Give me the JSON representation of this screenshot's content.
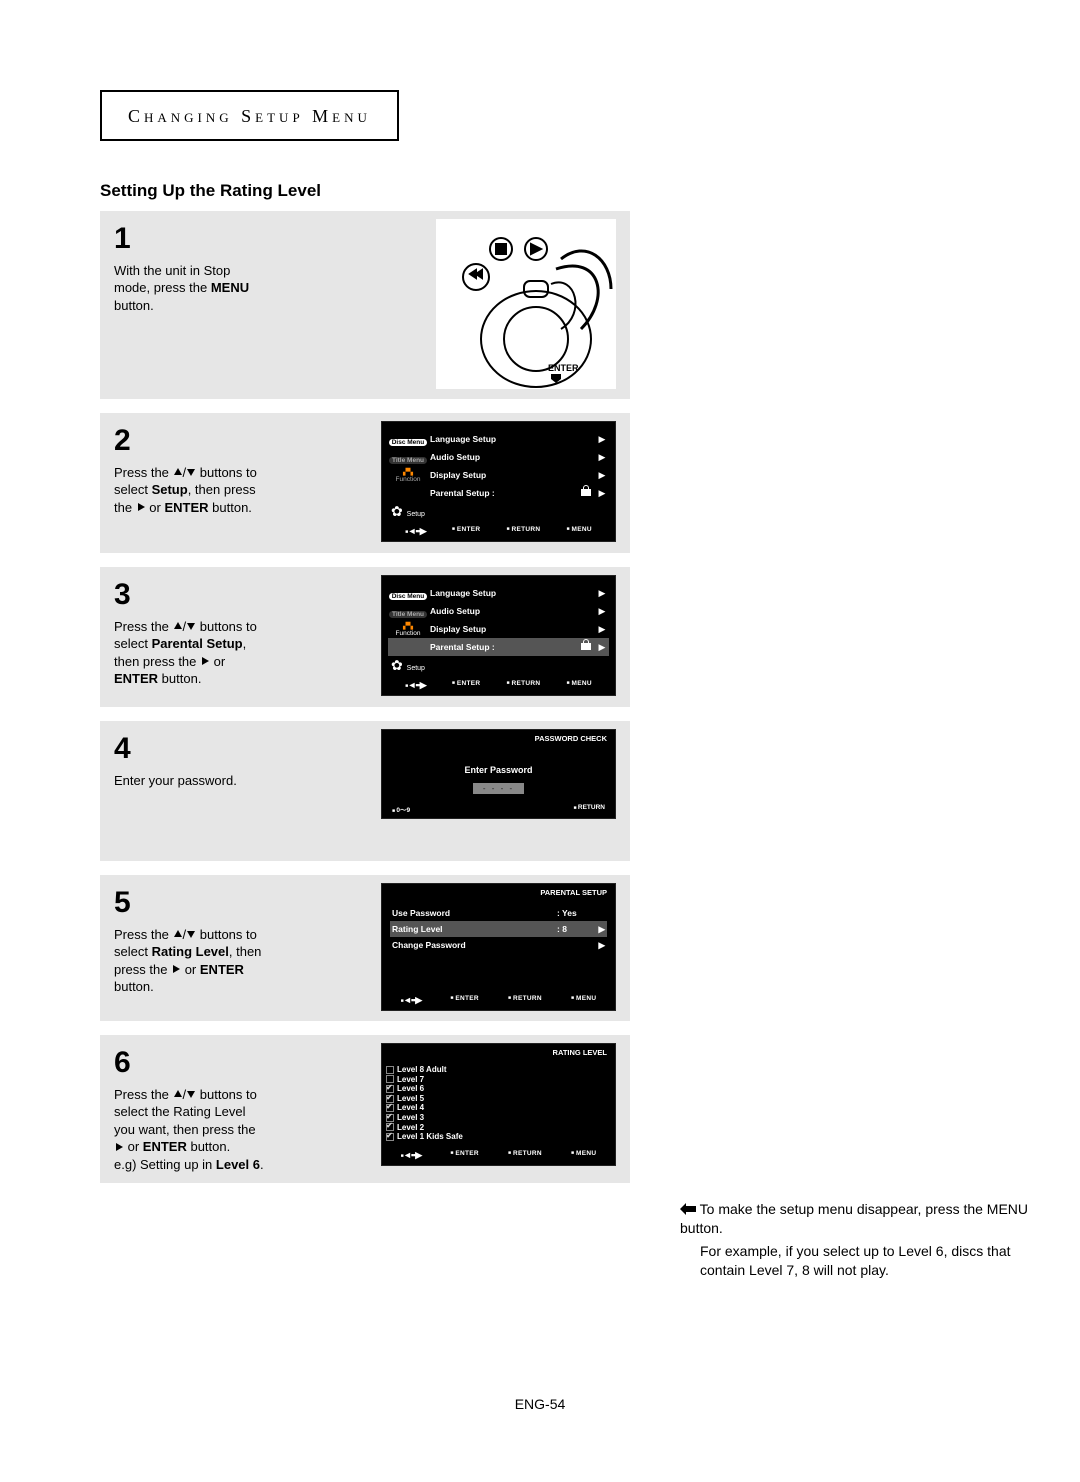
{
  "chapter": "Changing Setup Menu",
  "section_title": "Setting Up the Rating Level",
  "page_number": "ENG-54",
  "steps": {
    "s1": {
      "num": "1",
      "line1": "With the unit in Stop",
      "line2_pre": "mode, press the ",
      "line2_bold": "MENU",
      "line3": "button."
    },
    "s2": {
      "num": "2",
      "line1_pre": "Press the ",
      "line1_post": " buttons to",
      "line2_pre": "select ",
      "line2_bold": "Setup",
      "line2_post": ", then press",
      "line3_pre": "the ",
      "line3_post": " or ",
      "line3_bold": "ENTER",
      "line3_end": " button."
    },
    "s3": {
      "num": "3",
      "line1_pre": "Press the ",
      "line1_post": " buttons to",
      "line2_pre": "select ",
      "line2_bold": "Parental Setup",
      "line2_post": ",",
      "line3_pre": "then press the ",
      "line3_post": " or",
      "line4_bold": "ENTER",
      "line4_post": " button."
    },
    "s4": {
      "num": "4",
      "line1": "Enter your password."
    },
    "s5": {
      "num": "5",
      "line1_pre": "Press the ",
      "line1_post": " buttons to",
      "line2_pre": "select ",
      "line2_bold": "Rating Level",
      "line2_post": ", then",
      "line3_pre": "press the ",
      "line3_post": " or ",
      "line3_bold": "ENTER",
      "line4": "button."
    },
    "s6": {
      "num": "6",
      "line1_pre": "Press the ",
      "line1_post": " buttons to",
      "line2": "select the Rating Level",
      "line3": "you want, then press the",
      "line4_pre": "",
      "line4_mid": " or ",
      "line4_bold": "ENTER",
      "line4_post": " button.",
      "line5_pre": "e.g) Setting up in ",
      "line5_bold": "Level 6",
      "line5_post": "."
    }
  },
  "side_note": {
    "p1": "To make the setup menu disappear, press the MENU button.",
    "p2": "For example, if you select up to Level 6, discs that contain Level 7, 8 will not play."
  },
  "osd": {
    "side_labels": {
      "disc_menu": "Disc Menu",
      "title_menu": "Title Menu",
      "function": "Function",
      "setup": "Setup"
    },
    "setup_items": {
      "language": "Language Setup",
      "audio": "Audio Setup",
      "display": "Display Setup",
      "parental": "Parental Setup :"
    },
    "footer": {
      "enter": "ENTER",
      "return": "RETURN",
      "menu": "MENU"
    },
    "password_check": {
      "title": "PASSWORD CHECK",
      "label": "Enter Password",
      "mask": "- - - -",
      "nums": "0～9"
    },
    "parental_setup": {
      "title": "PARENTAL SETUP",
      "use_password": "Use Password",
      "use_password_val": ": Yes",
      "rating_level": "Rating Level",
      "rating_level_val": ": 8",
      "change_password": "Change Password"
    },
    "rating_level": {
      "title": "RATING LEVEL",
      "levels": [
        "Level 8 Adult",
        "Level 7",
        "Level 6",
        "Level 5",
        "Level 4",
        "Level 3",
        "Level 2",
        "Level 1 Kids Safe"
      ]
    },
    "remote_label": "ENTER"
  }
}
